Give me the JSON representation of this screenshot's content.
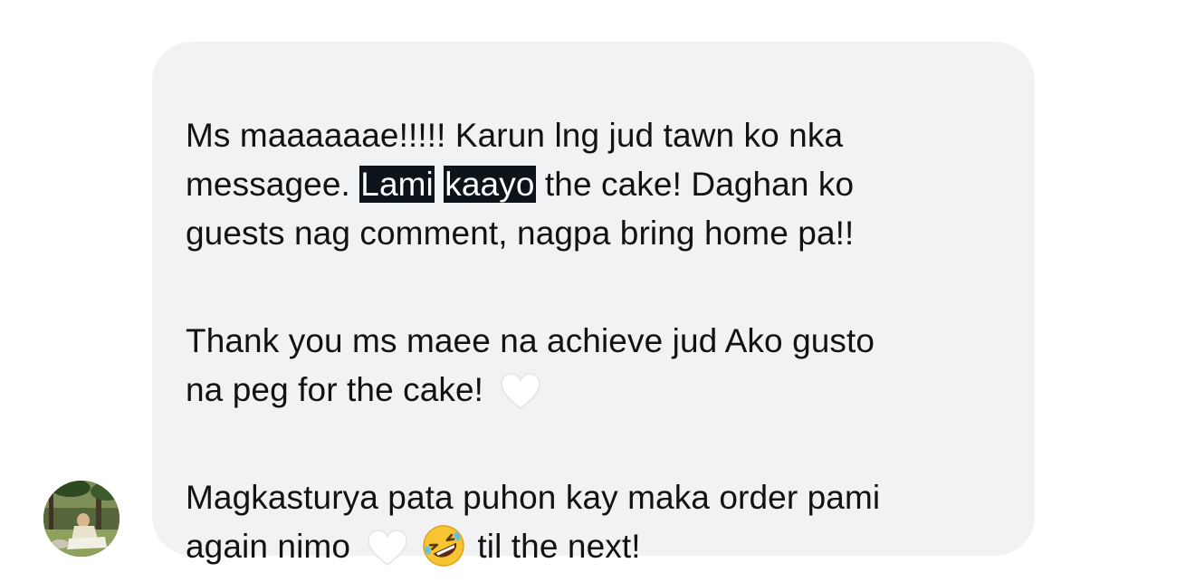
{
  "message": {
    "paragraph_1": {
      "line_1": "Ms maaaaaae!!!!! Karun lng jud tawn ko nka",
      "line_2_before": "messagee. ",
      "highlight_1": "Lami",
      "highlight_gap": " ",
      "highlight_2": "kaayo",
      "line_2_after": " the cake! Daghan ko",
      "line_3": "guests nag comment, nagpa bring home pa!!"
    },
    "paragraph_2": {
      "line_1": "Thank you ms maee na achieve jud Ako gusto",
      "line_2": "na peg for the cake! "
    },
    "paragraph_3": {
      "line_1": "Magkasturya pata puhon kay maka order pami",
      "line_2_before": "again nimo ",
      "line_2_after": "til the next!"
    }
  },
  "icons": {
    "heart": "white-heart-emoji",
    "laugh": "rolling-on-floor-laughing-emoji",
    "avatar": "sender-avatar"
  },
  "colors": {
    "bubble_background": "#f1f2f4",
    "text": "#101214",
    "highlight_background": "#0c1319",
    "highlight_text": "#ffffff"
  }
}
